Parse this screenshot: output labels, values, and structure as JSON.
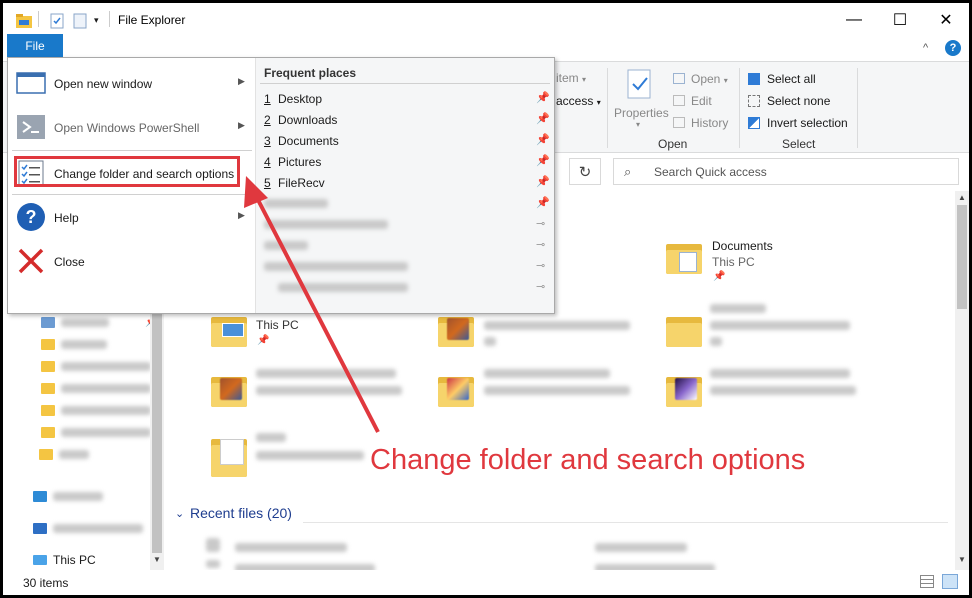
{
  "titlebar": {
    "title": "File Explorer",
    "minimize": "—",
    "maximize": "☐",
    "close": "✕"
  },
  "ribbon_help": {
    "collapse": "^",
    "help": "?"
  },
  "file_tab": {
    "label": "File"
  },
  "ribbon": {
    "item_new": "item",
    "easy_access": "access",
    "properties": "Properties",
    "open": "Open",
    "edit": "Edit",
    "history": "History",
    "select_all": "Select all",
    "select_none": "Select none",
    "invert_selection": "Invert selection",
    "group_open": "Open",
    "group_select": "Select"
  },
  "search": {
    "placeholder": "Search Quick access",
    "refresh": "↻"
  },
  "file_menu": {
    "items": [
      {
        "label": "Open new window",
        "has_arrow": true
      },
      {
        "label": "Open Windows PowerShell",
        "has_arrow": true
      },
      {
        "label": "Change folder and search options",
        "has_arrow": false
      },
      {
        "label": "Help",
        "has_arrow": true
      },
      {
        "label": "Close",
        "has_arrow": false
      }
    ],
    "arrow": "▶"
  },
  "frequent": {
    "header": "Frequent places",
    "items": [
      {
        "num": "1",
        "name": "Desktop"
      },
      {
        "num": "2",
        "name": "Downloads"
      },
      {
        "num": "3",
        "name": "Documents"
      },
      {
        "num": "4",
        "name": "Pictures"
      },
      {
        "num": "5",
        "name": "FileRecv"
      }
    ]
  },
  "nav": {
    "this_pc": "This PC"
  },
  "content": {
    "documents_title": "Documents",
    "documents_sub": "This PC",
    "desktop_sub": "This PC",
    "recent_header": "Recent files (20)"
  },
  "status": {
    "item_count": "30 items"
  },
  "annotation": {
    "text": "Change folder and search options",
    "color": "#e0383e"
  }
}
